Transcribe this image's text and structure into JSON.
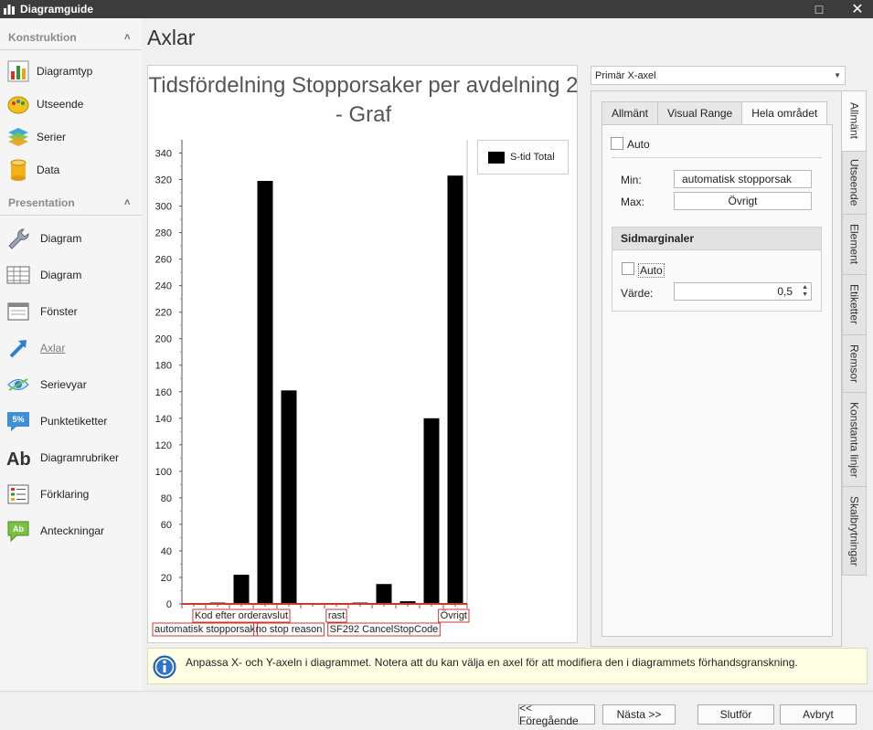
{
  "window": {
    "title": "Diagramguide",
    "maximize_glyph": "□",
    "close_glyph": "✕"
  },
  "sidebar": {
    "sections": [
      {
        "label": "Konstruktion",
        "items": [
          {
            "label": "Diagramtyp",
            "icon": "bar-chart-icon"
          },
          {
            "label": "Utseende",
            "icon": "palette-icon"
          },
          {
            "label": "Serier",
            "icon": "layers-icon"
          },
          {
            "label": "Data",
            "icon": "database-icon"
          }
        ]
      },
      {
        "label": "Presentation",
        "items": [
          {
            "label": "Diagram",
            "icon": "wrench-icon"
          },
          {
            "label": "Diagram",
            "icon": "grid-icon"
          },
          {
            "label": "Fönster",
            "icon": "window-icon"
          },
          {
            "label": "Axlar",
            "icon": "axis-arrow-icon",
            "active": true
          },
          {
            "label": "Serievyar",
            "icon": "eye-icon"
          },
          {
            "label": "Punktetiketter",
            "icon": "percent-label-icon"
          },
          {
            "label": "Diagramrubriker",
            "icon": "text-ab-icon"
          },
          {
            "label": "Förklaring",
            "icon": "legend-list-icon"
          },
          {
            "label": "Anteckningar",
            "icon": "note-icon"
          }
        ]
      }
    ],
    "collapse_glyph": "˄"
  },
  "page": {
    "title": "Axlar"
  },
  "chart_data": {
    "type": "bar",
    "title": "Tidsfördelning Stopporsaker per avdelning 2 - Graf",
    "legend": {
      "entries": [
        "S-tid Total"
      ],
      "position": "top-right",
      "color": "#000000"
    },
    "y_ticks": [
      0,
      20,
      40,
      60,
      80,
      100,
      120,
      140,
      160,
      180,
      200,
      220,
      240,
      260,
      280,
      300,
      320,
      340
    ],
    "ylim": [
      0,
      350
    ],
    "grid": false,
    "series": [
      {
        "name": "S-tid Total",
        "values": [
          0.5,
          1,
          22,
          319,
          161,
          0,
          0,
          1,
          15,
          2,
          140,
          323
        ]
      }
    ],
    "x_labels": [
      {
        "text": "automatisk stopporsak",
        "row": 2
      },
      {
        "text": "Kod efter orderavslut",
        "row": 1
      },
      {
        "text": "no stop reason",
        "row": 2
      },
      {
        "text": "rast",
        "row": 1
      },
      {
        "text": "SF292 CancelStopCode",
        "row": 2
      },
      {
        "text": "Övrigt",
        "row": 1
      }
    ]
  },
  "right_panel": {
    "axis_select": {
      "value": "Primär X-axel",
      "dropdown_glyph": "▼"
    },
    "tabs": [
      "Allmänt",
      "Visual Range",
      "Hela området"
    ],
    "active_tab": "Hela området",
    "auto_label": "Auto",
    "min_label": "Min:",
    "min_value": "automatisk stopporsak",
    "max_label": "Max:",
    "max_value": "Övrigt",
    "margins": {
      "title": "Sidmarginaler",
      "auto_label": "Auto",
      "value_label": "Värde:",
      "value": "0,5",
      "spin_up": "▲",
      "spin_down": "▼"
    },
    "vertical_tabs": [
      "Allmänt",
      "Utseende",
      "Element",
      "Etiketter",
      "Remsor",
      "Konstanta linjer",
      "Skalbrytningar"
    ]
  },
  "info": {
    "text": "Anpassa X- och Y-axeln i diagrammet. Notera att du kan välja en axel för att modifiera den i diagrammets förhandsgranskning.",
    "icon": "info-icon"
  },
  "buttons": {
    "previous": "<< Föregående",
    "next": "Nästa >>",
    "finish": "Slutför",
    "cancel": "Avbryt"
  }
}
